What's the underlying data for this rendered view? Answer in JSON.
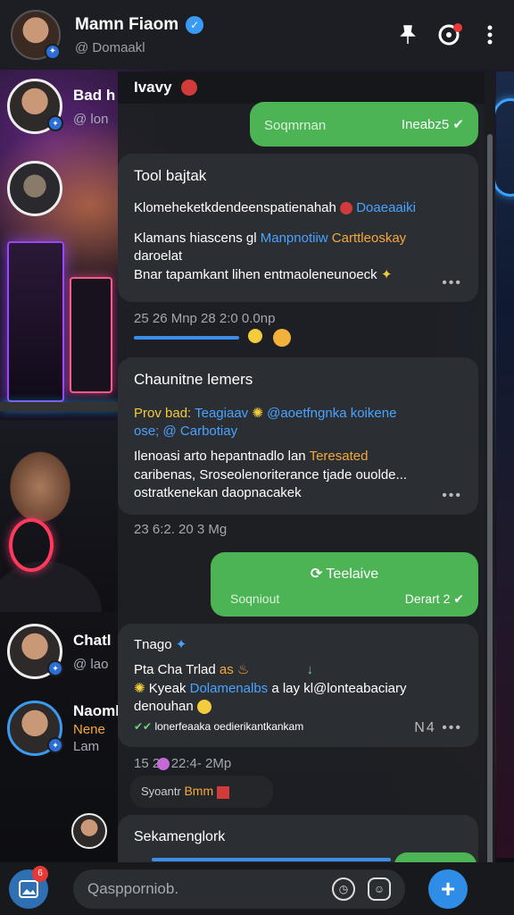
{
  "header": {
    "name": "Mamn Fiaom",
    "handle": "@ Domaakl"
  },
  "chats": [
    {
      "name": "Bad h",
      "sub": "@ lon"
    },
    {
      "name": "Chatl",
      "sub": "@ lao"
    },
    {
      "name": "Naoml",
      "sub": "Nene",
      "sub2": "Lam"
    }
  ],
  "panel": {
    "title": "Ivavy"
  },
  "messages": {
    "m1": {
      "left": "Soqmrnan",
      "right": "Ineabz5"
    },
    "m2": {
      "title": "Tool bajtak",
      "line1": "Klomeheketkdendeenspatienahah",
      "line1_link": "Doaeaaiki",
      "line2a": "Klamans hiascens gl",
      "line2b": "Manpnotiiw",
      "line2c": "Carttleoskay",
      "line3": "daroelat",
      "line4": "Bnar tapamkant lihen entmaoleneunoeck"
    },
    "meta1": "25  26 Mnp   28 2:0 0.0np",
    "m3": {
      "title": "Chaunitne lemers",
      "line1a": "Prov bad:",
      "line1b": "Teagiaav",
      "line1c": "@aoetfngnka koikene",
      "line2": "ose; @ Carbotiay",
      "line3a": "Ilenoasi arto hepantnadlo lan",
      "line3b": "Teresated",
      "line4": "caribenas, Sroseolenoriterance tjade ouolde...",
      "line5": "ostratkenekan daopnacakek"
    },
    "meta2": "23  6:2. 20 3 Mg",
    "m4": {
      "title": "Teelaive",
      "left": "Soqniout",
      "right": "Derart 2"
    },
    "m5": {
      "title": "Tnago",
      "line1": "Pta Cha Trlad",
      "line1b": "as",
      "line2a": "Kyeak",
      "line2b": "Dolamenalbs",
      "line2c": "a lay",
      "line2d": "kl@lonteabaciary",
      "line3": "denouhan",
      "line4a": "lonerfeaaka oedierikantkankam",
      "line4b": "N4"
    },
    "meta3": "15     26   22:4- 2Mp",
    "meta3b": "Syoantr",
    "meta3c": "Bmm",
    "m6": {
      "title": "Sekamenglork"
    }
  },
  "composer": {
    "placeholder": "Qaspporniob.",
    "badge": "6"
  },
  "colors": {
    "accent": "#2f8de8",
    "outgoing": "#4cb454",
    "incoming": "#2b2e33",
    "link": "#4aa3ff",
    "highlight": "#f4a93a"
  }
}
